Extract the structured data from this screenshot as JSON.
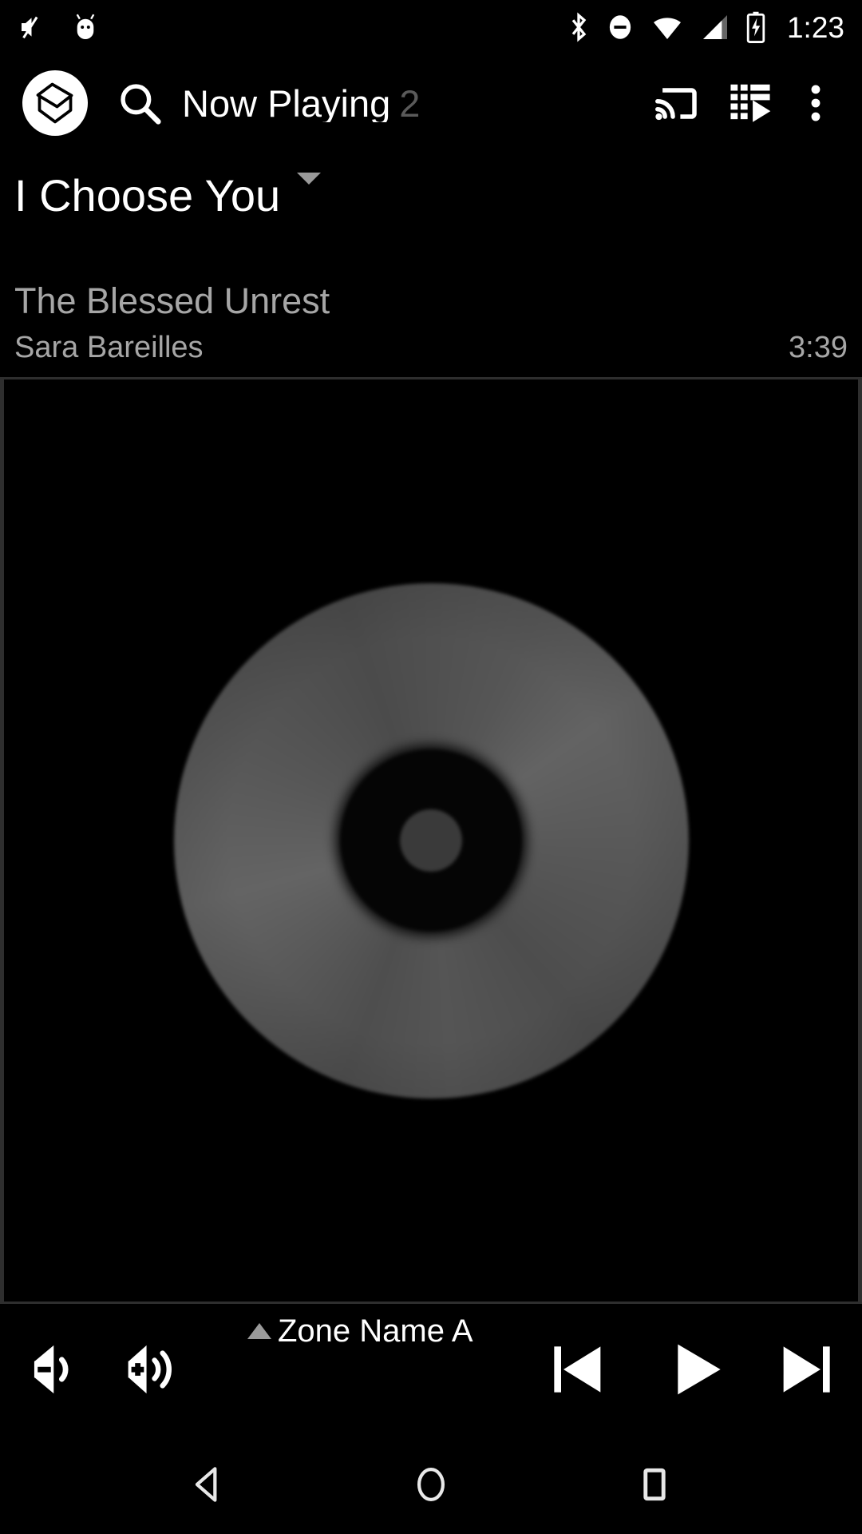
{
  "status_bar": {
    "time": "1:23",
    "left_icons": [
      {
        "name": "volume-mute-icon"
      },
      {
        "name": "android-head-icon"
      }
    ],
    "right_icons": [
      {
        "name": "bluetooth-icon"
      },
      {
        "name": "do-not-disturb-icon"
      },
      {
        "name": "wifi-icon"
      },
      {
        "name": "cellular-signal-icon"
      },
      {
        "name": "battery-charging-icon"
      }
    ]
  },
  "app_bar": {
    "logo_name": "app-logo-icon",
    "search_label": "search-icon",
    "title": "Now Playing",
    "title_badge": "2",
    "dropdown_name": "chevron-down-icon",
    "actions": [
      {
        "name": "cast-icon"
      },
      {
        "name": "play-queue-icon"
      },
      {
        "name": "overflow-menu-icon"
      }
    ]
  },
  "track": {
    "title": "I Choose You",
    "album": "The Blessed Unrest",
    "artist": "Sara Bareilles",
    "duration": "3:39"
  },
  "album_art": {
    "name": "album-art-cd-placeholder"
  },
  "controls": {
    "volume_down": "volume-down-icon",
    "volume_up": "volume-up-icon",
    "zone_caret": "chevron-up-icon",
    "zone_name": "Zone Name A",
    "previous": "previous-track-icon",
    "play": "play-icon",
    "next": "next-track-icon"
  },
  "nav_bar": {
    "back": "back-icon",
    "home": "home-icon",
    "recents": "recents-icon"
  },
  "colors": {
    "background": "#000000",
    "primary_text": "#ffffff",
    "secondary_text": "#a6a6a6",
    "dim_text": "#5a5a5a",
    "caret": "#9a9a9a",
    "frame_border": "#2e2e2e"
  }
}
